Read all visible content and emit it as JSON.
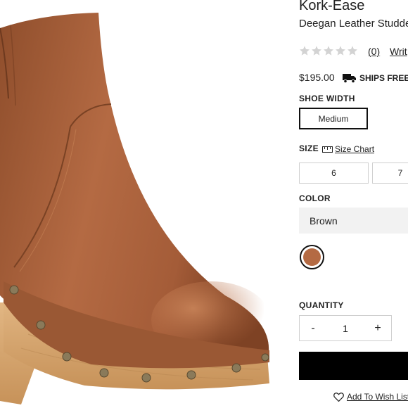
{
  "product": {
    "brand": "Kork-Ease",
    "name": "Deegan Leather Studde",
    "rating": {
      "stars_filled": 0,
      "stars_total": 5,
      "review_count": "(0)",
      "write_review": "Writ",
      "star_icon": "star-icon"
    },
    "price": "$195.00",
    "shipping": {
      "text": "SHIPS FREE -",
      "icon": "truck-icon"
    }
  },
  "shoe_width": {
    "label": "SHOE WIDTH",
    "selected": "Medium"
  },
  "size": {
    "label": "SIZE",
    "chart_link": "Size Chart",
    "chart_icon": "ruler-icon",
    "options": [
      "6",
      "7"
    ]
  },
  "color": {
    "label": "COLOR",
    "selected": "Brown",
    "swatch_color": "#b46a43"
  },
  "quantity": {
    "label": "QUANTITY",
    "minus": "-",
    "value": "1",
    "plus": "+"
  },
  "wishlist": {
    "label": "Add To Wish List",
    "icon": "heart-icon"
  },
  "colors": {
    "text": "#222222",
    "border": "#cfcfcf",
    "select_bg": "#f2f2f2",
    "cta_bg": "#000000",
    "leather": "#b46a43",
    "wood": "#d9a873"
  }
}
